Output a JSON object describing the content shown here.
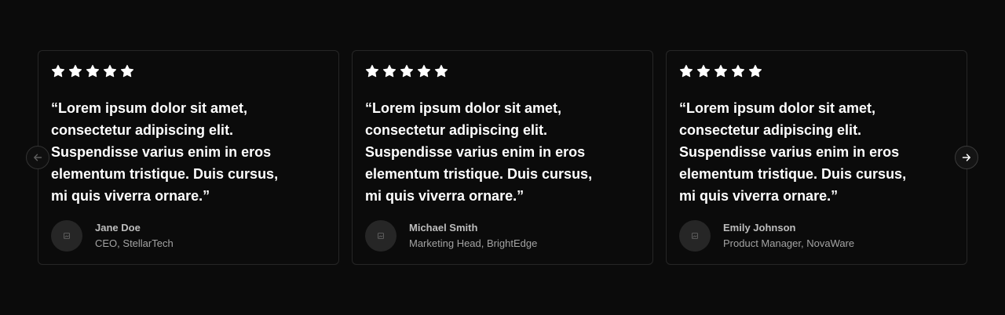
{
  "carousel": {
    "prev_icon": "arrow-left-icon",
    "next_icon": "arrow-right-icon",
    "rating_icon": "star-icon",
    "avatar_icon": "image-placeholder-icon",
    "colors": {
      "background": "#0b0b0b",
      "card_border": "#262626",
      "star": "#ffffff",
      "quote_text": "#ffffff",
      "name_text": "#bdbdbd",
      "role_text": "#a3a3a3",
      "avatar_bg": "#262626"
    },
    "testimonials": [
      {
        "rating": 5,
        "quote": "“Lorem ipsum dolor sit amet, consectetur adipiscing elit. Suspendisse varius enim in eros elementum tristique. Duis cursus, mi quis viverra ornare.”",
        "name": "Jane Doe",
        "role": "CEO, StellarTech"
      },
      {
        "rating": 5,
        "quote": "“Lorem ipsum dolor sit amet, consectetur adipiscing elit. Suspendisse varius enim in eros elementum tristique. Duis cursus, mi quis viverra ornare.”",
        "name": "Michael Smith",
        "role": "Marketing Head, BrightEdge"
      },
      {
        "rating": 5,
        "quote": "“Lorem ipsum dolor sit amet, consectetur adipiscing elit. Suspendisse varius enim in eros elementum tristique. Duis cursus, mi quis viverra ornare.”",
        "name": "Emily Johnson",
        "role": "Product Manager, NovaWare"
      }
    ]
  }
}
